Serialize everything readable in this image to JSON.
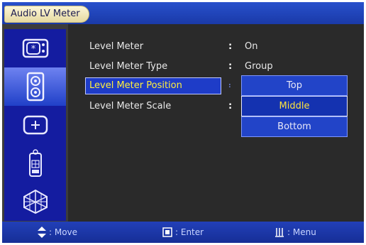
{
  "window": {
    "title": "Audio LV Meter"
  },
  "sidebar": {
    "items": [
      {
        "icon": "picture-settings-icon",
        "active": false
      },
      {
        "icon": "speaker-icon",
        "active": true
      },
      {
        "icon": "setup-icon",
        "active": false
      },
      {
        "icon": "remote-control-icon",
        "active": false
      },
      {
        "icon": "3d-cube-icon",
        "active": false
      }
    ]
  },
  "settings": [
    {
      "label": "Level Meter",
      "separator": ":",
      "value": "On"
    },
    {
      "label": "Level Meter Type",
      "separator": ":",
      "value": "Group"
    },
    {
      "label": "Level Meter Position",
      "separator": ":",
      "value": "",
      "selected": true
    },
    {
      "label": "Level Meter Scale",
      "separator": ":",
      "value": ""
    }
  ],
  "dropdown": {
    "options": [
      "Top",
      "Middle",
      "Bottom"
    ],
    "selected": "Middle"
  },
  "footer": {
    "move": ": Move",
    "enter": ": Enter",
    "menu": ": Menu"
  },
  "colors": {
    "title_bar": "#1a3aa8",
    "sidebar": "#141ca0",
    "content_bg": "#2a2a2a",
    "highlight_text": "#ffef3c",
    "option_bg": "#2244c8"
  }
}
